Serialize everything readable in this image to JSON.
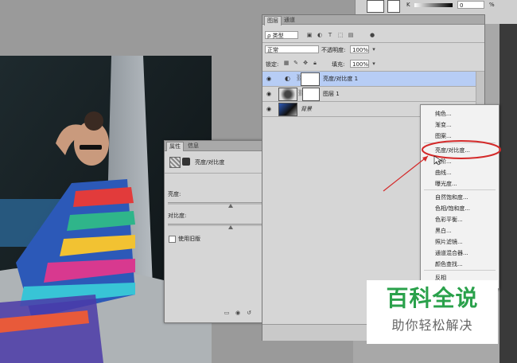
{
  "layers_panel": {
    "tabs": [
      "图层",
      "通道"
    ],
    "filter_label": "ρ 类型",
    "blend_mode": "正常",
    "opacity_label": "不透明度:",
    "opacity_value": "100%",
    "lock_label": "锁定:",
    "fill_label": "填充:",
    "fill_value": "100%",
    "layers": [
      {
        "name": "亮度/对比度 1",
        "selected": true
      },
      {
        "name": "图层 1",
        "selected": false
      },
      {
        "name": "背景",
        "selected": false
      }
    ]
  },
  "properties_panel": {
    "tabs": [
      "属性",
      "信息"
    ],
    "title": "亮度/对比度",
    "brightness_label": "亮度:",
    "contrast_label": "对比度:",
    "legacy_label": "使用旧版"
  },
  "context_menu": {
    "items": [
      "纯色...",
      "渐变...",
      "图案...",
      "亮度/对比度...",
      "色阶...",
      "曲线...",
      "曝光度...",
      "自然饱和度...",
      "色相/饱和度...",
      "色彩平衡...",
      "黑白...",
      "照片滤镜...",
      "通道混合器...",
      "颜色查找...",
      "反相"
    ],
    "highlighted": "亮度/对比度..."
  },
  "top_strip": {
    "k_label": "K",
    "k_value": "0",
    "percent": "%"
  },
  "watermark": {
    "line1": "百科全说",
    "line2": "助你轻松解决"
  },
  "colors": {
    "selected_row": "#b7cdf5",
    "annotation_red": "#d42a2a",
    "watermark_green": "#2aa14b"
  }
}
